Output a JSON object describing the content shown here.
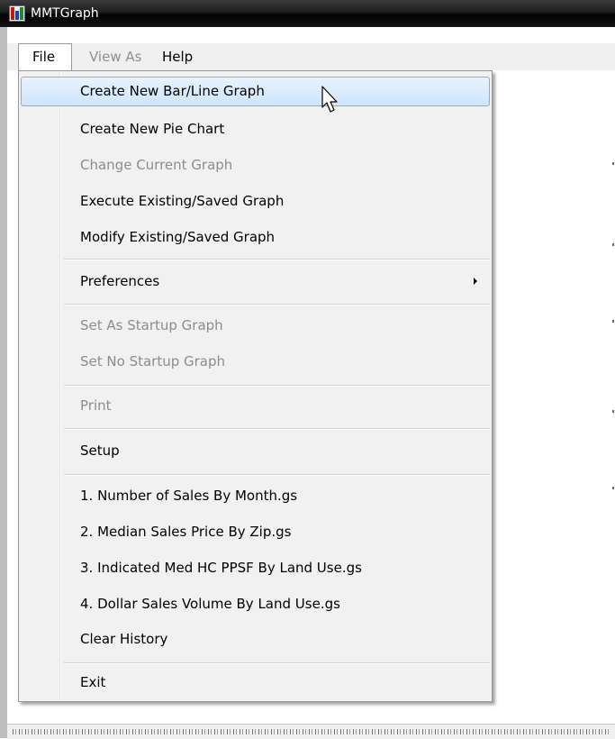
{
  "window": {
    "title": "MMTGraph",
    "icon": "bar-chart-app-icon"
  },
  "menubar": {
    "items": [
      {
        "label": "File",
        "state": "open"
      },
      {
        "label": "View As",
        "state": "disabled"
      },
      {
        "label": "Help",
        "state": "enabled"
      }
    ]
  },
  "file_menu": {
    "items": [
      {
        "label": "Create New Bar/Line Graph",
        "state": "highlighted"
      },
      {
        "label": "Create New Pie Chart",
        "state": "enabled"
      },
      {
        "label": "Change Current Graph",
        "state": "disabled"
      },
      {
        "label": "Execute Existing/Saved Graph",
        "state": "enabled"
      },
      {
        "label": "Modify Existing/Saved Graph",
        "state": "enabled"
      },
      {
        "label": "Preferences",
        "state": "enabled",
        "has_submenu": true
      },
      {
        "label": "Set As Startup Graph",
        "state": "disabled"
      },
      {
        "label": "Set No Startup Graph",
        "state": "disabled"
      },
      {
        "label": "Print",
        "state": "disabled"
      },
      {
        "label": "Setup",
        "state": "enabled"
      },
      {
        "label": "1. Number of Sales By Month.gs",
        "state": "enabled"
      },
      {
        "label": "2. Median Sales Price By Zip.gs",
        "state": "enabled"
      },
      {
        "label": "3. Indicated Med HC PPSF By Land Use.gs",
        "state": "enabled"
      },
      {
        "label": "4. Dollar Sales Volume By Land Use.gs",
        "state": "enabled"
      },
      {
        "label": "Clear History",
        "state": "enabled"
      },
      {
        "label": "Exit",
        "state": "enabled"
      }
    ]
  },
  "colors": {
    "titlebar": "#000000",
    "highlight_fill": "#cfe5fb",
    "highlight_border": "#7fb0e5",
    "disabled_text": "#8c8c8c",
    "menu_background": "#f1f1f1"
  }
}
